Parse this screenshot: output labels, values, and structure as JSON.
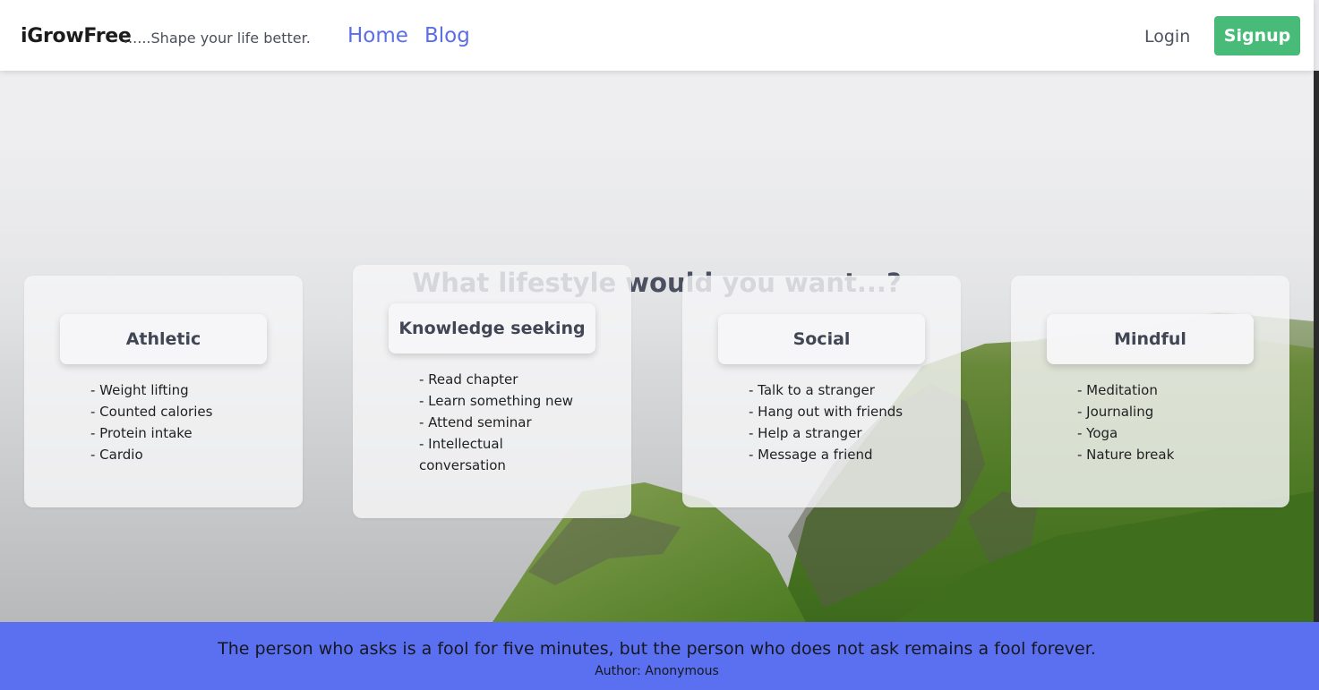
{
  "navbar": {
    "brand": "iGrowFree",
    "tagline": "......Shape your life better.",
    "links": [
      "Home",
      "Blog"
    ],
    "login": "Login",
    "signup": "Signup"
  },
  "hero": {
    "title": "What lifestyle would you want...?"
  },
  "cards": [
    {
      "title": "Athletic",
      "items": [
        "- Weight lifting",
        "- Counted calories",
        "- Protein intake",
        "- Cardio"
      ]
    },
    {
      "title": "Knowledge seeking",
      "items": [
        "- Read chapter",
        "- Learn something new",
        "- Attend seminar",
        "- Intellectual conversation"
      ]
    },
    {
      "title": "Social",
      "items": [
        "- Talk to a stranger",
        "- Hang out with friends",
        "- Help a stranger",
        "- Message a friend"
      ]
    },
    {
      "title": "Mindful",
      "items": [
        "- Meditation",
        "- Journaling",
        "- Yoga",
        "- Nature break"
      ]
    }
  ],
  "footer": {
    "quote": "The person who asks is a fool for five minutes, but the person who does not ask remains a fool forever.",
    "author": "Author: Anonymous"
  },
  "colors": {
    "accent_link": "#5b6ee8",
    "signup_bg": "#48bb78",
    "footer_bg": "#5b70f0"
  },
  "background": "mountain-landscape"
}
